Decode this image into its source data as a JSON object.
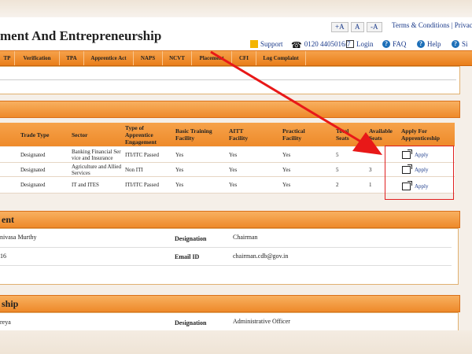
{
  "header": {
    "title": "ment And Entrepreneurship",
    "font_controls": [
      "+A",
      "A",
      "-A"
    ],
    "utility_links": [
      "Terms & Conditions",
      "Privacy F"
    ],
    "support": "Support",
    "phone": "0120 4405016/7",
    "login": "Login",
    "faq": "FAQ",
    "help": "Help",
    "site_truncated": "Si"
  },
  "nav": {
    "items": [
      "TP",
      "Verification",
      "TPA",
      "Apprentice Act",
      "NAPS",
      "NCVT",
      "Placement",
      "CFI",
      "Log Complaint"
    ]
  },
  "table": {
    "headers": [
      "Trade Type",
      "Sector",
      "Type of Apprentice Engagement",
      "Basic Training Facility",
      "AITT Facility",
      "Practical Facility",
      "Total Seats",
      "Available Seats",
      "Apply For Apprenticeship"
    ],
    "rows": [
      {
        "trade_type": "Designated",
        "sector": "Banking Financial Ser vice and Insurance",
        "engagement": "ITI/ITC Passed",
        "basic": "Yes",
        "aitt": "Yes",
        "practical": "Yes",
        "total": "5",
        "available": "",
        "apply": "Apply"
      },
      {
        "trade_type": "Designated",
        "sector": "Agriculture and Allied Services",
        "engagement": "Non ITI",
        "basic": "Yes",
        "aitt": "Yes",
        "practical": "Yes",
        "total": "5",
        "available": "3",
        "apply": "Apply"
      },
      {
        "trade_type": "Designated",
        "sector": "IT and ITES",
        "engagement": "ITI/ITC Passed",
        "basic": "Yes",
        "aitt": "Yes",
        "practical": "Yes",
        "total": "2",
        "available": "1",
        "apply": "Apply"
      }
    ]
  },
  "section1": {
    "heading": "ent",
    "name_partial": "nivasa Murthy",
    "designation_label": "Designation",
    "designation_value": "Chairman",
    "phone_partial": "16",
    "email_label": "Email ID",
    "email_value": "chairman.cdb@gov.in"
  },
  "section2": {
    "heading": "ship",
    "name_partial": "reya",
    "designation_label": "Designation",
    "designation_value": "Administrative Officer"
  },
  "colors": {
    "accent": "#ee8a2a",
    "highlight": "#e02020",
    "link": "#1a3a8a"
  }
}
